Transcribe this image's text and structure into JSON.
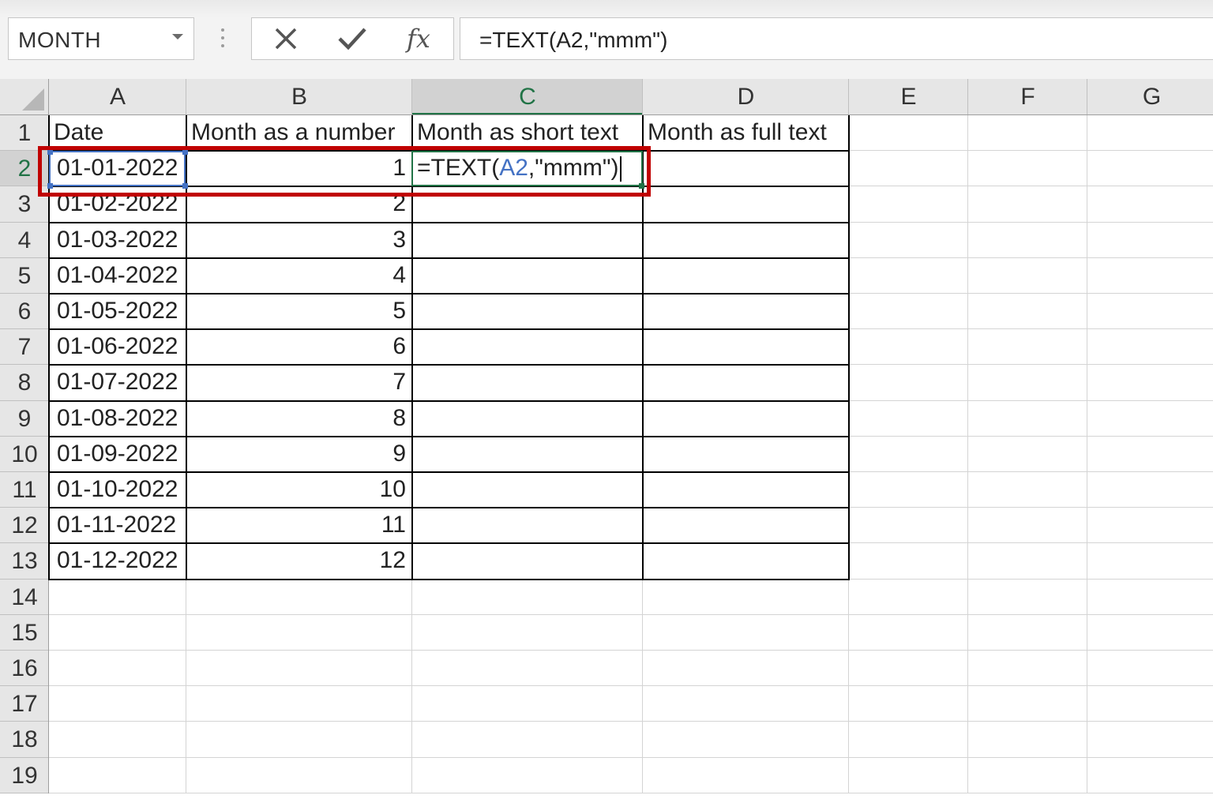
{
  "name_box": {
    "value": "MONTH",
    "dropdown_icon": "chevron-down-icon"
  },
  "formula_buttons": {
    "cancel_icon": "close-icon",
    "enter_icon": "check-icon",
    "function_icon": "fx-icon",
    "function_label": "fx"
  },
  "formula_bar": {
    "value": "=TEXT(A2,\"mmm\")"
  },
  "columns": [
    "A",
    "B",
    "C",
    "D",
    "E",
    "F",
    "G"
  ],
  "selected_column": "C",
  "rows": [
    "1",
    "2",
    "3",
    "4",
    "5",
    "6",
    "7",
    "8",
    "9",
    "10",
    "11",
    "12",
    "13",
    "14",
    "15",
    "16",
    "17",
    "18",
    "19"
  ],
  "selected_row": "2",
  "headers": {
    "a": "Date",
    "b": "Month as a number",
    "c": "Month as short text",
    "d": "Month as full text"
  },
  "table": [
    {
      "date": "01-01-2022",
      "month_num": "1"
    },
    {
      "date": "01-02-2022",
      "month_num": "2"
    },
    {
      "date": "01-03-2022",
      "month_num": "3"
    },
    {
      "date": "01-04-2022",
      "month_num": "4"
    },
    {
      "date": "01-05-2022",
      "month_num": "5"
    },
    {
      "date": "01-06-2022",
      "month_num": "6"
    },
    {
      "date": "01-07-2022",
      "month_num": "7"
    },
    {
      "date": "01-08-2022",
      "month_num": "8"
    },
    {
      "date": "01-09-2022",
      "month_num": "9"
    },
    {
      "date": "01-10-2022",
      "month_num": "10"
    },
    {
      "date": "01-11-2022",
      "month_num": "11"
    },
    {
      "date": "01-12-2022",
      "month_num": "12"
    }
  ],
  "editing_cell": {
    "ref": "C2",
    "prefix": "=TEXT(",
    "reference": "A2",
    "suffix": ",\"mmm\")"
  },
  "colors": {
    "accent_green": "#217346",
    "reference_blue": "#4472c4",
    "highlight_red": "#c00000"
  }
}
